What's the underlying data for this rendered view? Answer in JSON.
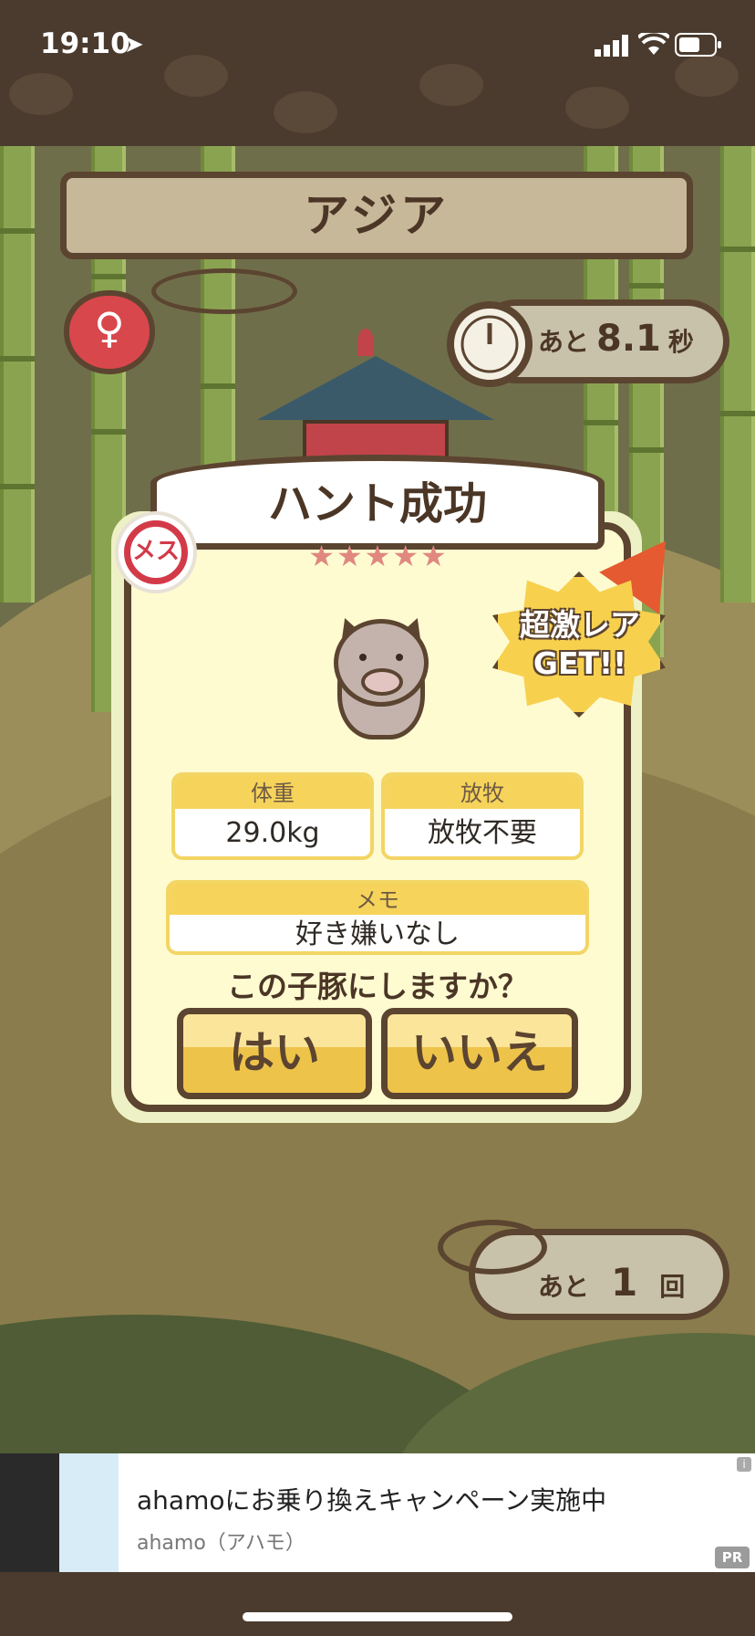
{
  "status_bar": {
    "time": "19:10"
  },
  "game": {
    "region": "アジア",
    "timer": {
      "prefix": "あと",
      "value": "8.1",
      "unit": "秒"
    },
    "card": {
      "title": "ハント成功",
      "stars": "★★★★★",
      "sex_badge": "メス",
      "rare_line1": "超激レア",
      "rare_line2": "GET!!",
      "weight_label": "体重",
      "weight_value": "29.0kg",
      "grazing_label": "放牧",
      "grazing_value": "放牧不要",
      "memo_label": "メモ",
      "memo_value": "好き嫌いなし",
      "question": "この子豚にしますか？",
      "yes": "はい",
      "no": "いいえ"
    },
    "remaining": {
      "prefix": "あと",
      "value": "1",
      "unit": "回"
    }
  },
  "ad": {
    "title": "ahamoにお乗り換えキャンペーン実施中",
    "subtitle": "ahamo（アハモ）",
    "pr": "PR"
  }
}
